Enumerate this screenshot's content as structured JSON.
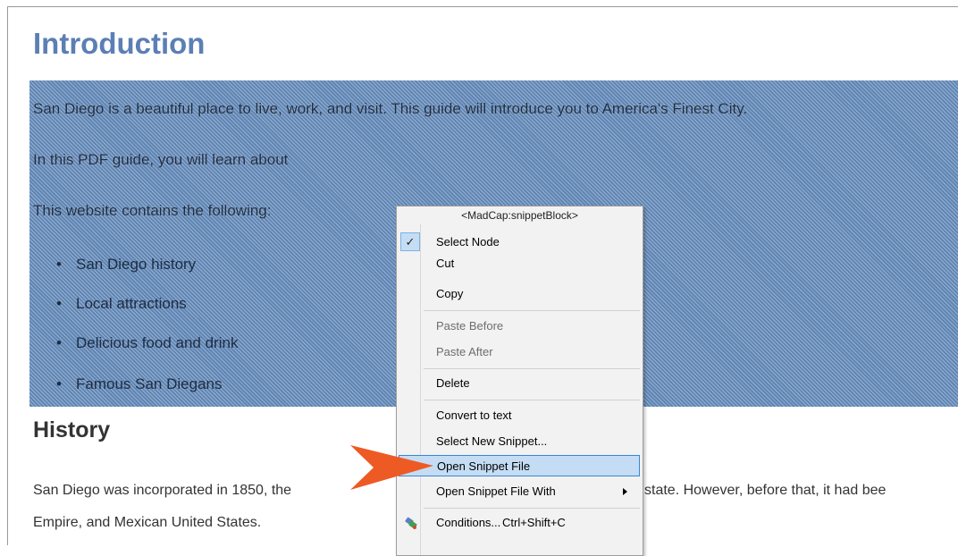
{
  "page": {
    "title": "Introduction",
    "snippet": {
      "line1": "San Diego is a beautiful place to live, work, and visit. This guide will introduce you to America's Finest City.",
      "line2": "In this PDF guide, you will learn about",
      "line3": "This website contains the following:",
      "bullets": [
        "San Diego history",
        "Local attractions",
        "Delicious food and drink",
        "Famous San Diegans"
      ]
    },
    "history_heading": "History",
    "history_line1_left": "San Diego was incorporated in 1850, the",
    "history_line1_right": "state. However, before that, it had bee",
    "history_line2": "Empire, and Mexican United States."
  },
  "context_menu": {
    "header": "<MadCap:snippetBlock>",
    "items": {
      "select_node": "Select Node",
      "cut": "Cut",
      "copy": "Copy",
      "paste_before": "Paste Before",
      "paste_after": "Paste After",
      "delete": "Delete",
      "convert_to_text": "Convert to text",
      "select_new_snippet": "Select New Snippet...",
      "open_snippet_file": "Open Snippet File",
      "open_snippet_file_with": "Open Snippet File With",
      "conditions": "Conditions...",
      "conditions_shortcut": "Ctrl+Shift+C"
    },
    "icons": {
      "check": "✓",
      "conditions": "conditions-icon",
      "submenu": "chevron-right-icon"
    }
  },
  "colors": {
    "heading_blue": "#5b7fb5",
    "selection_fill": "#5f85b4",
    "menu_highlight": "#c5ddf4",
    "callout_arrow": "#ee5a24"
  }
}
